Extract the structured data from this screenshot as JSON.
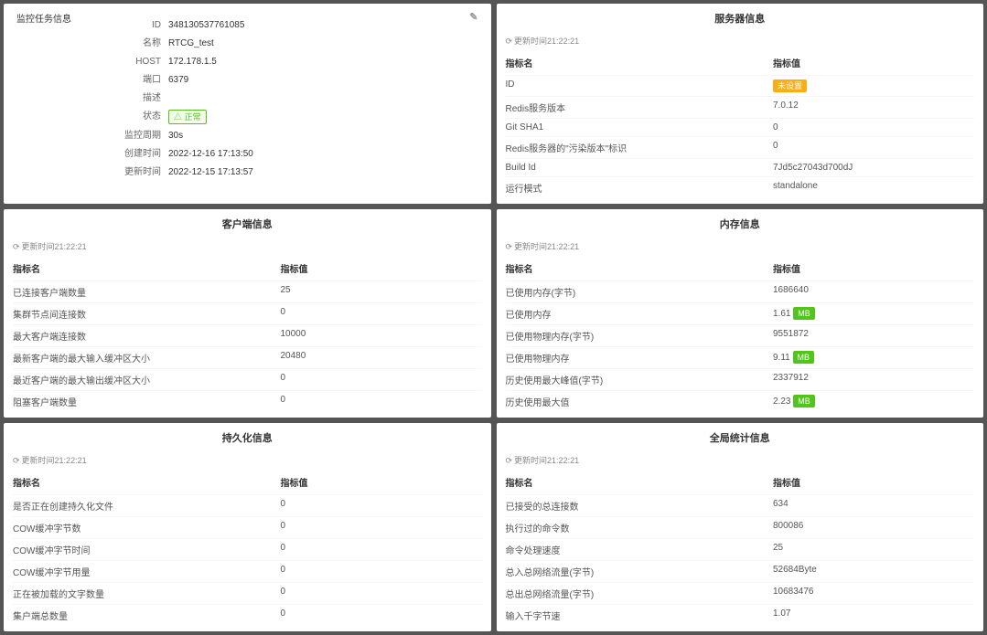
{
  "panels": {
    "task": {
      "title": "监控任务信息",
      "rows": [
        {
          "label": "ID",
          "value": "348130537761085"
        },
        {
          "label": "名称",
          "value": "RTCG_test"
        },
        {
          "label": "HOST",
          "value": "172.178.1.5"
        },
        {
          "label": "端口",
          "value": "6379"
        },
        {
          "label": "描述",
          "value": ""
        },
        {
          "label": "状态",
          "value": "正常",
          "tag": "green-outline"
        },
        {
          "label": "监控周期",
          "value": "30s"
        },
        {
          "label": "创建时间",
          "value": "2022-12-16 17:13:50"
        },
        {
          "label": "更新时间",
          "value": "2022-12-15 17:13:57"
        }
      ]
    },
    "server": {
      "title": "服务器信息",
      "refresh": "更新时间21:22:21",
      "headers": [
        "指标名",
        "指标值"
      ],
      "rows": [
        {
          "k": "ID",
          "v": "未设置",
          "tag": "orange"
        },
        {
          "k": "Redis服务版本",
          "v": "7.0.12"
        },
        {
          "k": "Git SHA1",
          "v": "0"
        },
        {
          "k": "Redis服务器的\"污染版本\"标识",
          "v": "0"
        },
        {
          "k": "Build Id",
          "v": "7Jd5c27043d700dJ"
        },
        {
          "k": "运行模式",
          "v": "standalone"
        }
      ]
    },
    "client": {
      "title": "客户端信息",
      "refresh": "更新时间21:22:21",
      "headers": [
        "指标名",
        "指标值"
      ],
      "rows": [
        {
          "k": "已连接客户端数量",
          "v": "25"
        },
        {
          "k": "集群节点间连接数",
          "v": "0"
        },
        {
          "k": "最大客户端连接数",
          "v": "10000"
        },
        {
          "k": "最新客户端的最大输入缓冲区大小",
          "v": "20480"
        },
        {
          "k": "最近客户端的最大输出缓冲区大小",
          "v": "0"
        },
        {
          "k": "阻塞客户端数量",
          "v": "0"
        }
      ]
    },
    "memory": {
      "title": "内存信息",
      "refresh": "更新时间21:22:21",
      "headers": [
        "指标名",
        "指标值"
      ],
      "rows": [
        {
          "k": "已使用内存(字节)",
          "v": "1686640"
        },
        {
          "k": "已使用内存",
          "v": "1.61",
          "unit": "MB",
          "tag": "green"
        },
        {
          "k": "已使用物理内存(字节)",
          "v": "9551872"
        },
        {
          "k": "已使用物理内存",
          "v": "9.11",
          "unit": "MB",
          "tag": "green"
        },
        {
          "k": "历史使用最大峰值(字节)",
          "v": "2337912"
        },
        {
          "k": "历史使用最大值",
          "v": "2.23",
          "unit": "MB",
          "tag": "green"
        }
      ]
    },
    "persist": {
      "title": "持久化信息",
      "refresh": "更新时间21:22:21",
      "headers": [
        "指标名",
        "指标值"
      ],
      "rows": [
        {
          "k": "是否正在创建持久化文件",
          "v": "0"
        },
        {
          "k": "COW缓冲字节数",
          "v": "0"
        },
        {
          "k": "COW缓冲字节时间",
          "v": "0"
        },
        {
          "k": "COW缓冲字节用量",
          "v": "0"
        },
        {
          "k": "正在被加载的文字数量",
          "v": "0"
        },
        {
          "k": "集户端总数量",
          "v": "0"
        }
      ]
    },
    "stats": {
      "title": "全局统计信息",
      "refresh": "更新时间21:22:21",
      "headers": [
        "指标名",
        "指标值"
      ],
      "rows": [
        {
          "k": "已接受的总连接数",
          "v": "634"
        },
        {
          "k": "执行过的命令数",
          "v": "800086"
        },
        {
          "k": "命令处理速度",
          "v": "25"
        },
        {
          "k": "总入总网络流量(字节)",
          "v": "52684Byte"
        },
        {
          "k": "总出总网络流量(字节)",
          "v": "10683476"
        },
        {
          "k": "输入千字节速",
          "v": "1.07"
        }
      ]
    }
  }
}
